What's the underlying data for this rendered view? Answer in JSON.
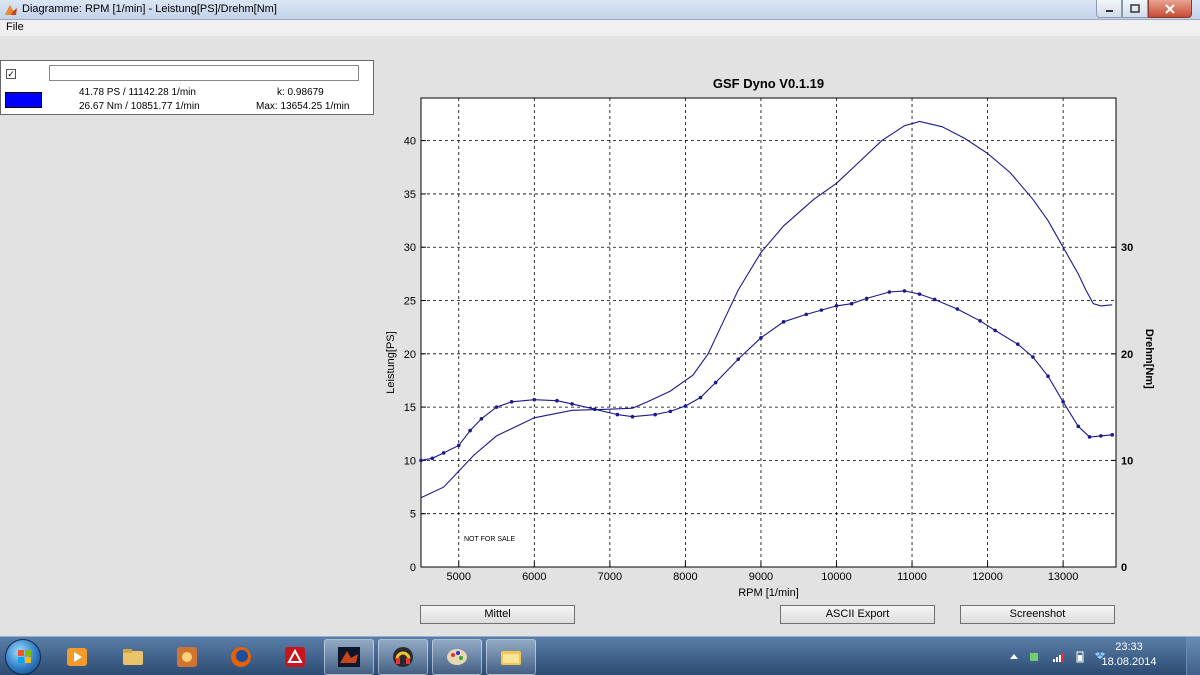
{
  "window": {
    "title": "Diagramme: RPM [1/min] - Leistung[PS]/Drehm[Nm]",
    "minimize_icon": "minimize-icon",
    "maximize_icon": "maximize-icon",
    "close_icon": "close-icon"
  },
  "menu": {
    "file": "File"
  },
  "legend": {
    "checked": "✓",
    "name_value": "",
    "swatch_color": "#0000ff",
    "power_peak": "41.78 PS / 11142.28 1/min",
    "torque_peak": "26.67 Nm / 10851.77 1/min",
    "k_value": "k: 0.98679",
    "max_rpm": "Max: 13654.25 1/min"
  },
  "watermark": "NOT FOR SALE",
  "buttons": {
    "mittel": "Mittel",
    "ascii_export": "ASCII Export",
    "screenshot": "Screenshot"
  },
  "colors": {
    "series": "#1a1a8c",
    "plot_bg": "#ffffff",
    "grid": "#000000"
  },
  "chart_data": {
    "type": "line",
    "title": "GSF Dyno V0.1.19",
    "xlabel": "RPM [1/min]",
    "ylabel": "Leistung[PS]",
    "ylabel_right": "Drehm[Nm]",
    "xlim": [
      4500,
      13700
    ],
    "ylim": [
      0,
      44
    ],
    "ylim_right": [
      0,
      44
    ],
    "xticks": [
      5000,
      6000,
      7000,
      8000,
      9000,
      10000,
      11000,
      12000,
      13000
    ],
    "yticks": [
      0,
      5,
      10,
      15,
      20,
      25,
      30,
      35,
      40
    ],
    "yticks_right": [
      0,
      10,
      20,
      30
    ],
    "grid": true,
    "legend": "top-left",
    "series": [
      {
        "name": "Leistung[PS]",
        "axis": "left",
        "markers": false,
        "x": [
          4500,
          4800,
          5000,
          5200,
          5500,
          6000,
          6500,
          7000,
          7300,
          7500,
          7800,
          8100,
          8300,
          8500,
          8700,
          9000,
          9300,
          9700,
          10000,
          10300,
          10600,
          10900,
          11100,
          11400,
          11700,
          12000,
          12300,
          12600,
          12800,
          13000,
          13200,
          13300,
          13400,
          13500,
          13650
        ],
        "y": [
          6.5,
          7.5,
          9.0,
          10.5,
          12.3,
          14.0,
          14.7,
          14.8,
          14.9,
          15.5,
          16.5,
          18.0,
          20.0,
          23.0,
          26.0,
          29.5,
          32.0,
          34.5,
          36.0,
          38.0,
          40.0,
          41.4,
          41.8,
          41.3,
          40.2,
          38.8,
          37.0,
          34.5,
          32.5,
          30.0,
          27.5,
          26.0,
          24.7,
          24.5,
          24.6
        ]
      },
      {
        "name": "Drehm[Nm]",
        "axis": "right",
        "markers": true,
        "x": [
          4500,
          4650,
          4800,
          5000,
          5150,
          5300,
          5500,
          5700,
          6000,
          6300,
          6500,
          6800,
          7100,
          7300,
          7600,
          7800,
          8000,
          8200,
          8400,
          8700,
          9000,
          9300,
          9600,
          9800,
          10000,
          10200,
          10400,
          10700,
          10900,
          11100,
          11300,
          11600,
          11900,
          12100,
          12400,
          12600,
          12800,
          13000,
          13200,
          13350,
          13500,
          13650
        ],
        "y": [
          10.0,
          10.2,
          10.7,
          11.4,
          12.8,
          13.9,
          15.0,
          15.5,
          15.7,
          15.6,
          15.3,
          14.8,
          14.3,
          14.1,
          14.3,
          14.6,
          15.1,
          15.9,
          17.3,
          19.5,
          21.5,
          23.0,
          23.7,
          24.1,
          24.5,
          24.7,
          25.2,
          25.8,
          25.9,
          25.6,
          25.1,
          24.2,
          23.1,
          22.2,
          20.9,
          19.7,
          17.9,
          15.5,
          13.2,
          12.2,
          12.3,
          12.4
        ]
      }
    ]
  }
}
